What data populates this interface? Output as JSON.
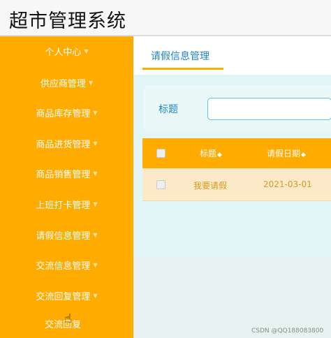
{
  "app": {
    "title": "超市管理系统"
  },
  "sidebar": {
    "items": [
      {
        "label": "个人中心"
      },
      {
        "label": "供应商管理"
      },
      {
        "label": "商品库存管理"
      },
      {
        "label": "商品进货管理"
      },
      {
        "label": "商品销售管理"
      },
      {
        "label": "上班打卡管理"
      },
      {
        "label": "请假信息管理"
      },
      {
        "label": "交流信息管理"
      },
      {
        "label": "交流回复管理"
      },
      {
        "label": "交流回复"
      }
    ],
    "caret_icon": "chevron-down-icon"
  },
  "main": {
    "tab": {
      "label": "请假信息管理"
    },
    "search": {
      "label": "标题",
      "value": "",
      "placeholder": ""
    },
    "table": {
      "columns": [
        {
          "label": "标题",
          "sortable": true
        },
        {
          "label": "请假日期",
          "sortable": true
        }
      ],
      "rows": [
        {
          "title": "我要请假",
          "date": "2021-03-01"
        }
      ]
    }
  },
  "watermark": "CSDN @QQ188083800",
  "colors": {
    "accent": "#ffab00",
    "link": "#1f86c5",
    "panel": "#e3f6f6"
  }
}
